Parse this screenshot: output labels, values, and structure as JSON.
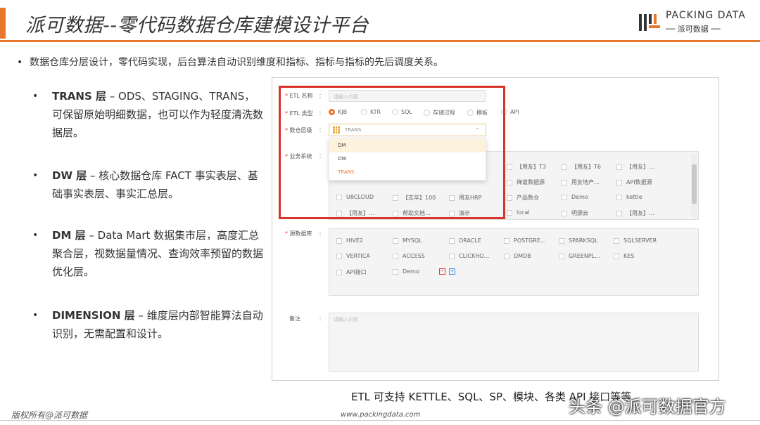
{
  "header": {
    "title": "派可数据--零代码数据仓库建模设计平台",
    "logo_en": "PACKING DATA",
    "logo_cn": "── 派可数据 ──",
    "accent": "#e8772e"
  },
  "intro": "数据仓库分层设计，零代码实现，后台算法自动识别维度和指标、指标与指标的先后调度关系。",
  "bullets": [
    {
      "bold": "TRANS 层",
      "text": " – ODS、STAGING、TRANS，可保留原始明细数据，也可以作为轻度清洗数据层。"
    },
    {
      "bold": "DW 层",
      "text": " – 核心数据仓库 FACT 事实表层、基础事实表层、事实汇总层。"
    },
    {
      "bold": "DM 层",
      "text": " – Data Mart 数据集市层，高度汇总聚合层，视数据量情况、查询效率预留的数据优化层。"
    },
    {
      "bold": "DIMENSION 层",
      "text": " – 维度层内部智能算法自动识别，无需配置和设计。"
    }
  ],
  "form": {
    "etl_name_label": "ETL 名称",
    "etl_name_placeholder": "请输入内容",
    "etl_type_label": "ETL 类型",
    "etl_types": [
      "KJB",
      "KTR",
      "SQL",
      "存储过程",
      "模板",
      "API"
    ],
    "data_layer_label": "数仓层级",
    "data_layer_value": "TRANS",
    "layer_options": [
      "DM",
      "DW",
      "TRANS"
    ],
    "biz_label": "业务系统",
    "biz_systems": [
      [
        "【用友】T3",
        "【用友】T6",
        "【用友】…"
      ],
      [
        "禅道数据源",
        "用友地产…",
        "API数据源"
      ],
      [
        "U8CLOUD",
        "【志华】100",
        "用友HRP",
        "产品数仓",
        "Demo",
        "kettle"
      ],
      [
        "【用友】…",
        "帮助文档…",
        "演示",
        "local",
        "明源云",
        "【用友】…"
      ]
    ],
    "src_label": "源数据库",
    "source_dbs": [
      [
        "HIVE2",
        "MYSQL",
        "ORACLE",
        "POSTGRE…",
        "SPARKSQL",
        "SQLSERVER"
      ],
      [
        "VERTICA",
        "ACCESS",
        "CLICKHO…",
        "DMDB",
        "GREENPL…",
        "KES"
      ],
      [
        "API接口",
        "Demo"
      ]
    ],
    "note_label": "备注",
    "note_placeholder": "请输入内容",
    "colon": "："
  },
  "caption": "ETL 可支持 KETTLE、SQL、SP、模块、各类 API 接口等等",
  "footer": {
    "left": "版权所有@派可数据",
    "right": "www.packingdata.com"
  },
  "watermark": "头条 @派可数据官方"
}
